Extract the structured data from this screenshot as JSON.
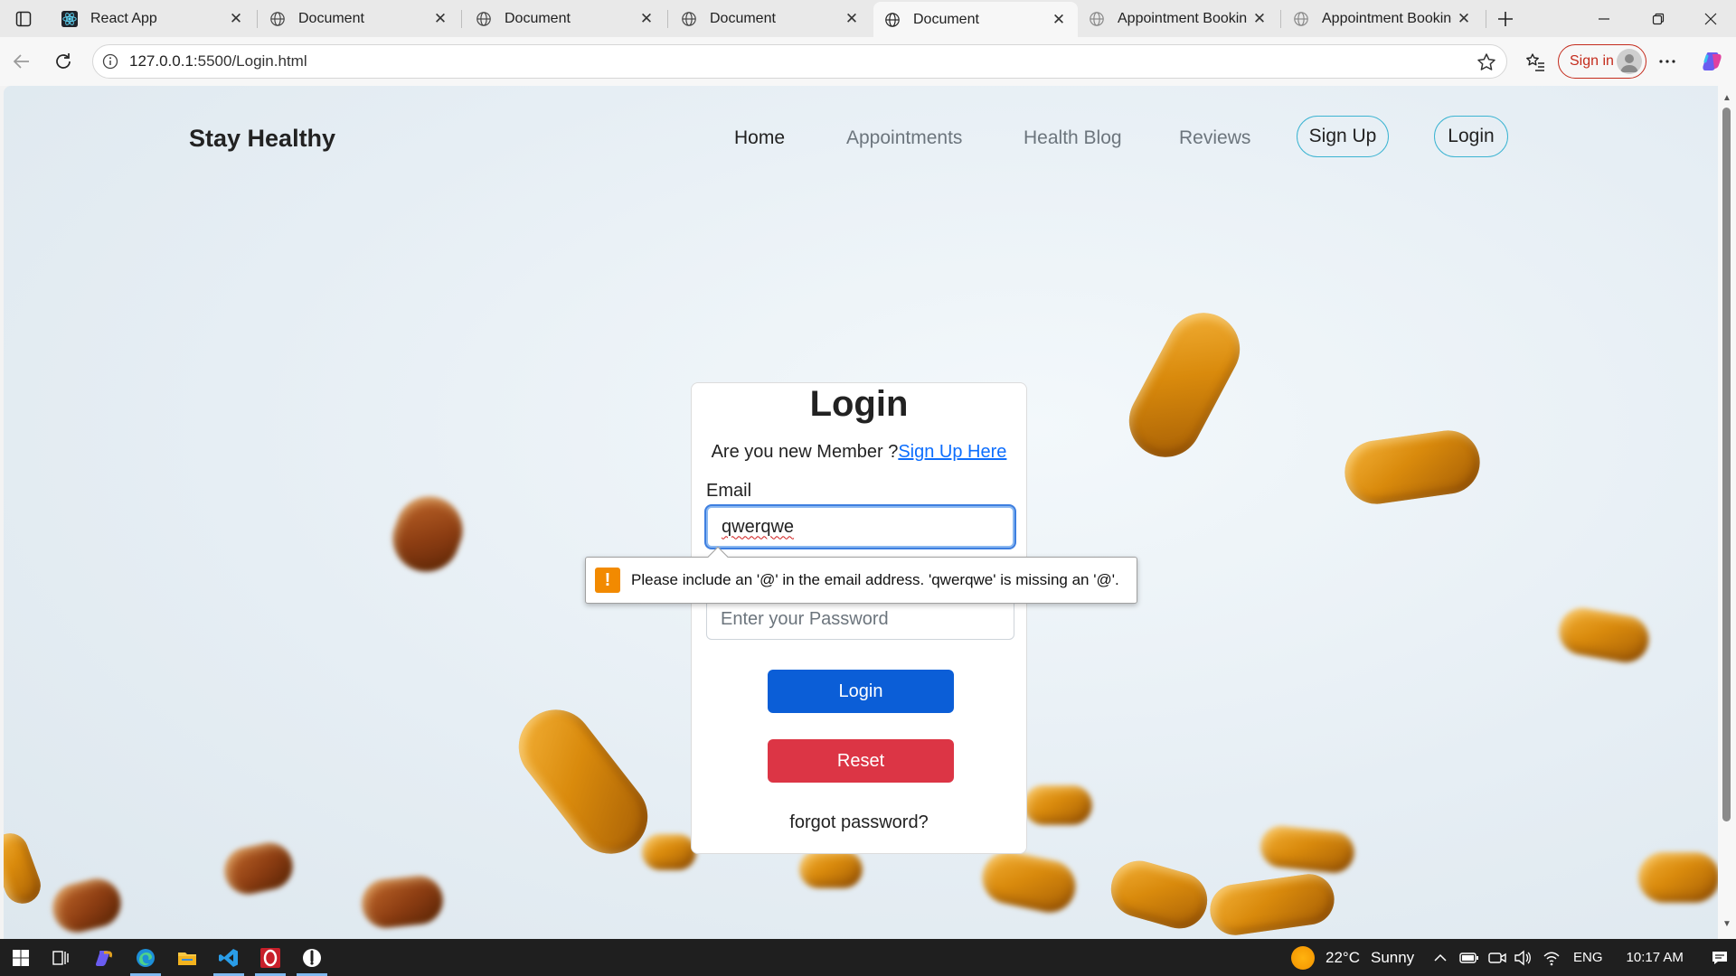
{
  "browser": {
    "tabs": [
      {
        "title": "React App",
        "icon": "react-icon",
        "active": false
      },
      {
        "title": "Document",
        "icon": "globe-icon",
        "active": false
      },
      {
        "title": "Document",
        "icon": "globe-icon",
        "active": false
      },
      {
        "title": "Document",
        "icon": "globe-icon",
        "active": false
      },
      {
        "title": "Document",
        "icon": "globe-icon",
        "active": true
      },
      {
        "title": "Appointment Booking",
        "icon": "globe-icon",
        "active": false
      },
      {
        "title": "Appointment Booking",
        "icon": "globe-icon",
        "active": false
      }
    ],
    "address": {
      "host": "127.0.0.1",
      "path": ":5500/Login.html"
    },
    "signin_label": "Sign in"
  },
  "page": {
    "brand": "Stay Healthy",
    "nav": {
      "home": "Home",
      "appointments": "Appointments",
      "health_blog": "Health Blog",
      "reviews": "Reviews",
      "signup": "Sign Up",
      "login": "Login"
    },
    "login_card": {
      "title": "Login",
      "member_prompt": "Are you new Member ?",
      "signup_link": "Sign Up Here",
      "email_label": "Email",
      "email_value": "qwerqwe",
      "password_placeholder": "Enter your Password",
      "login_button": "Login",
      "reset_button": "Reset",
      "forgot_link": "forgot password?"
    },
    "validation_tooltip": "Please include an '@' in the email address. 'qwerqwe' is missing an '@'."
  },
  "taskbar": {
    "weather": {
      "temp": "22°C",
      "condition": "Sunny"
    },
    "language": "ENG",
    "time": "10:17 AM"
  },
  "colors": {
    "primary": "#0b5ed7",
    "danger": "#dc3545",
    "nav_pill_border": "#3cb4d2",
    "link": "#0d6efd",
    "warning": "#f28a00"
  }
}
